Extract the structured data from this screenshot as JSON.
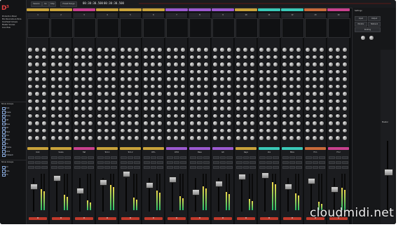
{
  "app": {
    "logo": "D³"
  },
  "sidebar": {
    "items": [
      "Production Mixer",
      "Mix Panorama & More",
      "Overhead Groups",
      "Master Scenes",
      "Live View"
    ],
    "groups_title": "Show Groups",
    "groups": [
      "Kick",
      "Snare",
      "Toms",
      "OH",
      "Bass",
      "Gtr",
      "Keys",
      "Vox",
      "BVox",
      "FX",
      "Tracks",
      "Click",
      "Ambient"
    ],
    "bottom_title": "Show Groups",
    "bottom_items": [
      "All",
      "VCA",
      "FX"
    ]
  },
  "transport": {
    "buttons": [
      "Session",
      "Go",
      "Stop",
      "Preset Range",
      "Mix"
    ],
    "timecode1": "00:30:30.500",
    "timecode2": "00:30:30.500"
  },
  "channels": [
    {
      "id": "1",
      "name": "Kick",
      "color": "#c8a23a"
    },
    {
      "id": "2",
      "name": "Snare",
      "color": "#c8a23a"
    },
    {
      "id": "3",
      "name": "Hat",
      "color": "#c8418e"
    },
    {
      "id": "4",
      "name": "Tom 1",
      "color": "#c8a23a"
    },
    {
      "id": "5",
      "name": "Tom 2",
      "color": "#c8a23a"
    },
    {
      "id": "6",
      "name": "OH L",
      "color": "#c8a23a"
    },
    {
      "id": "7",
      "name": "OH R",
      "color": "#9b59d0"
    },
    {
      "id": "8",
      "name": "Bass",
      "color": "#9b59d0"
    },
    {
      "id": "9",
      "name": "Gtr",
      "color": "#9b59d0"
    },
    {
      "id": "10",
      "name": "Keys",
      "color": "#c8a23a"
    },
    {
      "id": "11",
      "name": "Vox",
      "color": "#3ac8b7"
    },
    {
      "id": "12",
      "name": "BVox",
      "color": "#3ac8b7"
    },
    {
      "id": "13",
      "name": "FX 1",
      "color": "#c86a3a"
    },
    {
      "id": "14",
      "name": "FX 2",
      "color": "#c8418e"
    }
  ],
  "mute_label": "M",
  "right_panel": {
    "title": "Settings",
    "labels": [
      "Input",
      "Output",
      "Monitor",
      "Talkback",
      "Routing"
    ],
    "master_name": "Master"
  },
  "watermark": "cloudmidi.net"
}
